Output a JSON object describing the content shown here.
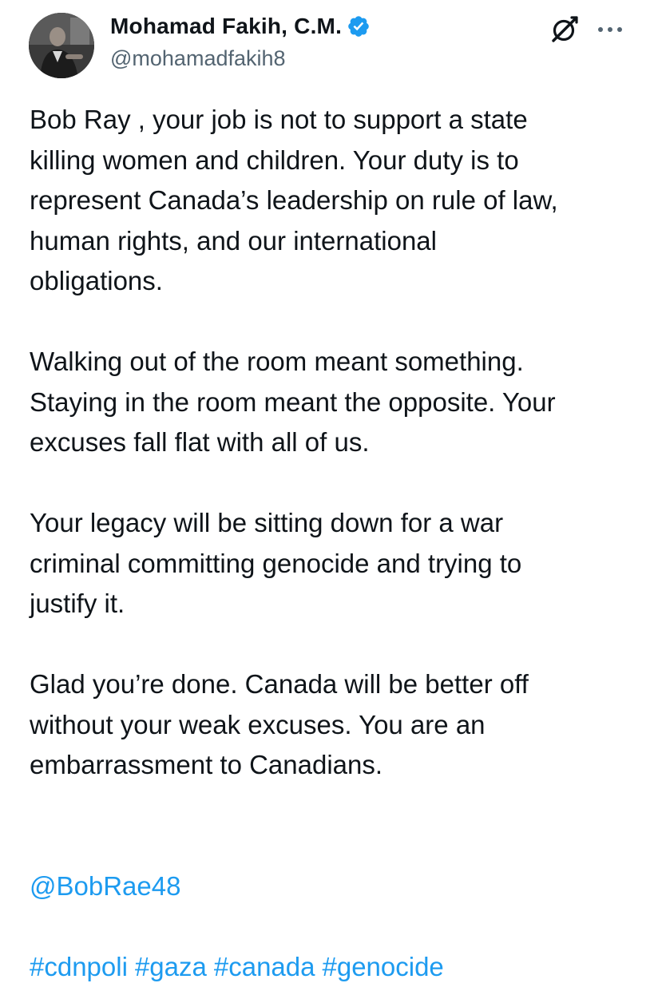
{
  "author": {
    "display_name": "Mohamad Fakih, C.M.",
    "handle": "@mohamadfakih8",
    "verified": true
  },
  "icons": {
    "verified": "verified-badge-icon",
    "grok": "grok-icon",
    "more": "more-options-icon"
  },
  "colors": {
    "text": "#0f1419",
    "secondary_text": "#536471",
    "link": "#1d9bf0",
    "verified_badge": "#1d9bf0"
  },
  "tweet": {
    "paragraphs": [
      "Bob Ray  , your job is not to support a state\nkilling women and children. Your duty is to\nrepresent Canada’s leadership on rule of law,\nhuman rights, and our international\nobligations.",
      "Walking out of the room meant something.\nStaying in the room meant the opposite. Your\nexcuses fall flat with all of us.",
      "Your legacy will be sitting down for a war\ncriminal committing genocide and trying to\njustify it.",
      "Glad you’re done. Canada will be better off\nwithout your weak excuses. You are an\nembarrassment to Canadians."
    ],
    "mention": "@BobRae48",
    "hashtags": [
      "#cdnpoli",
      "#gaza",
      "#canada",
      "#genocide"
    ]
  }
}
